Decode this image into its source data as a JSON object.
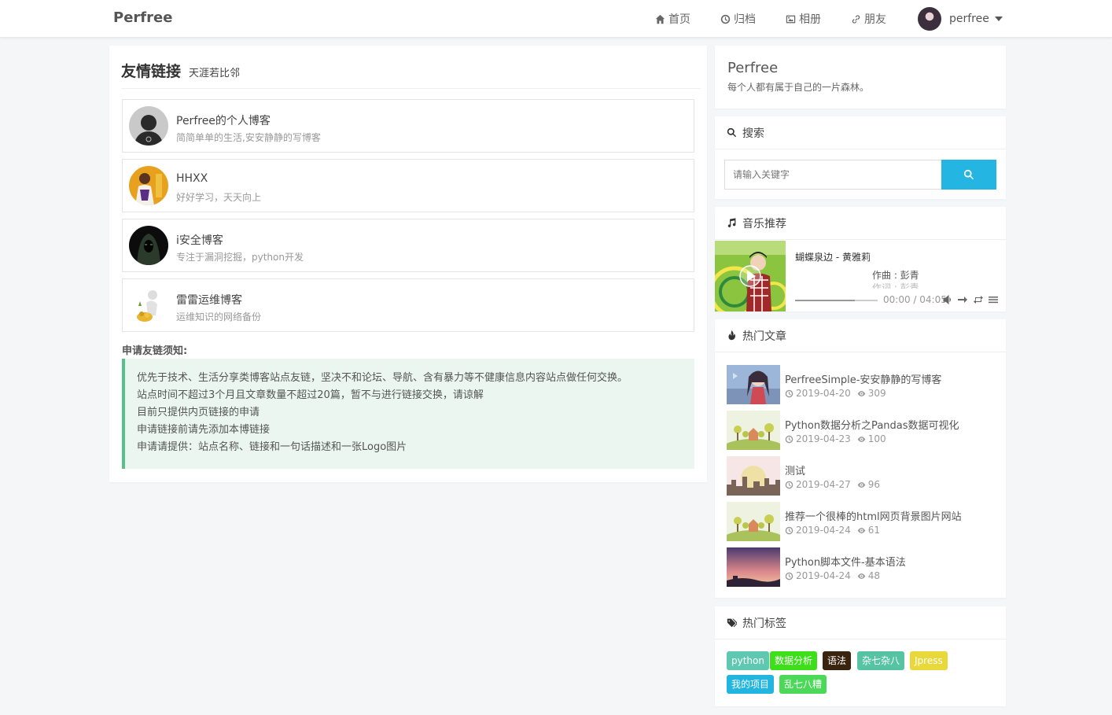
{
  "nav": {
    "brand": "Perfree",
    "items": [
      {
        "label": "首页",
        "icon": "home-icon"
      },
      {
        "label": "归档",
        "icon": "clock-icon"
      },
      {
        "label": "相册",
        "icon": "image-icon"
      },
      {
        "label": "朋友",
        "icon": "link-icon"
      }
    ],
    "user": "perfree"
  },
  "main": {
    "title": "友情链接",
    "subtitle": "天涯若比邻",
    "links": [
      {
        "name": "Perfree的个人博客",
        "desc": "简简单单的生活,安安静静的写博客"
      },
      {
        "name": "HHXX",
        "desc": "好好学习，天天向上"
      },
      {
        "name": "i安全博客",
        "desc": "专注于漏洞挖掘，python开发"
      },
      {
        "name": "雷雷运维博客",
        "desc": "运维知识的网络备份"
      }
    ],
    "notice_title": "申请友链须知:",
    "notice_lines": [
      "优先于技术、生活分享类博客站点友链，坚决不和论坛、导航、含有暴力等不健康信息内容站点做任何交换。",
      "站点时间不超过3个月且文章数量不超过20篇，暂不与进行链接交换，请谅解",
      "目前只提供内页链接的申请",
      "申请链接前请先添加本博链接",
      "申请请提供：站点名称、链接和一句话描述和一张Logo图片"
    ]
  },
  "sidebar": {
    "about": {
      "title": "Perfree",
      "desc": "每个人都有属于自己的一片森林。"
    },
    "search": {
      "title": "搜索",
      "placeholder": "请输入关键字"
    },
    "music": {
      "title": "音乐推荐",
      "song": "蝴蝶泉边 - 黄雅莉",
      "lrc_line1": "作曲 : 彭青",
      "lrc_line2": "作词 : 彭青",
      "time": "00:00 / 04:05",
      "progress": 0.72
    },
    "hot_articles": {
      "title": "热门文章",
      "items": [
        {
          "title": "PerfreeSimple-安安静静的写博客",
          "date": "2019-04-20",
          "views": "309"
        },
        {
          "title": "Python数据分析之Pandas数据可视化",
          "date": "2019-04-23",
          "views": "100"
        },
        {
          "title": "测试",
          "date": "2019-04-27",
          "views": "96"
        },
        {
          "title": "推荐一个很棒的html网页背景图片网站",
          "date": "2019-04-24",
          "views": "61"
        },
        {
          "title": "Python脚本文件-基本语法",
          "date": "2019-04-24",
          "views": "48"
        }
      ]
    },
    "hot_tags": {
      "title": "热门标签",
      "items": [
        {
          "label": "python",
          "color": "#5ec8b0"
        },
        {
          "label": "数据分析",
          "color": "#3ddf1b"
        },
        {
          "label": "语法",
          "color": "#3a2410"
        },
        {
          "label": "杂七杂八",
          "color": "#56c4a0"
        },
        {
          "label": "Jpress",
          "color": "#e9d83a"
        },
        {
          "label": "我的项目",
          "color": "#22b5e0"
        },
        {
          "label": "乱七八糟",
          "color": "#4cd95a"
        }
      ]
    }
  }
}
